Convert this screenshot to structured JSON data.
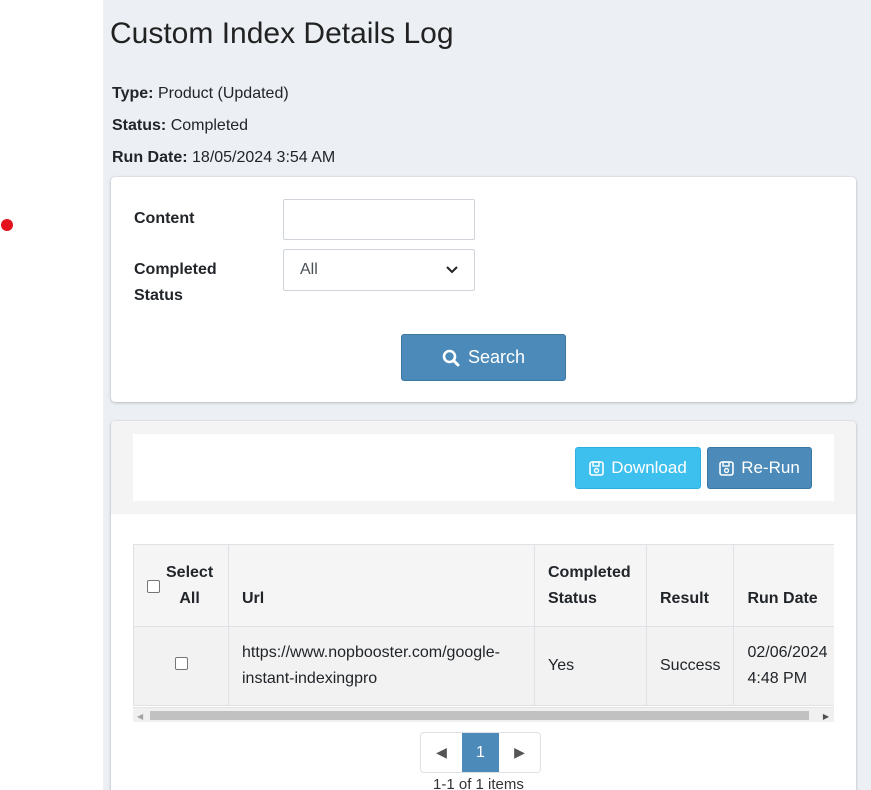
{
  "page": {
    "title": "Custom Index Details Log"
  },
  "info": {
    "type_label": "Type:",
    "type_value": "Product (Updated)",
    "status_label": "Status:",
    "status_value": "Completed",
    "run_date_label": "Run Date:",
    "run_date_value": "18/05/2024 3:54 AM"
  },
  "search_form": {
    "content_label": "Content",
    "content_value": "",
    "completed_status_label_1": "Completed",
    "completed_status_label_2": "Status",
    "completed_status_selected": "All",
    "search_button": "Search"
  },
  "toolbar": {
    "download_button": "Download",
    "rerun_button": "Re-Run"
  },
  "table": {
    "headers": {
      "select_all_1": "Select",
      "select_all_2": "All",
      "url": "Url",
      "completed_status_1": "Completed",
      "completed_status_2": "Status",
      "result": "Result",
      "run_date": "Run Date"
    },
    "rows": [
      {
        "url_line1": "https://www.nopbooster.com/google-",
        "url_line2": "instant-indexingpro",
        "completed_status": "Yes",
        "result": "Success",
        "run_date_line1": "02/06/2024",
        "run_date_line2": "4:48 PM"
      }
    ]
  },
  "pagination": {
    "current_page": "1",
    "info": "1-1 of 1 items"
  },
  "colors": {
    "primary": "#4b8ab9",
    "info": "#3ec0ef",
    "background": "#ecf0f5",
    "indicator": "#e3121d"
  }
}
